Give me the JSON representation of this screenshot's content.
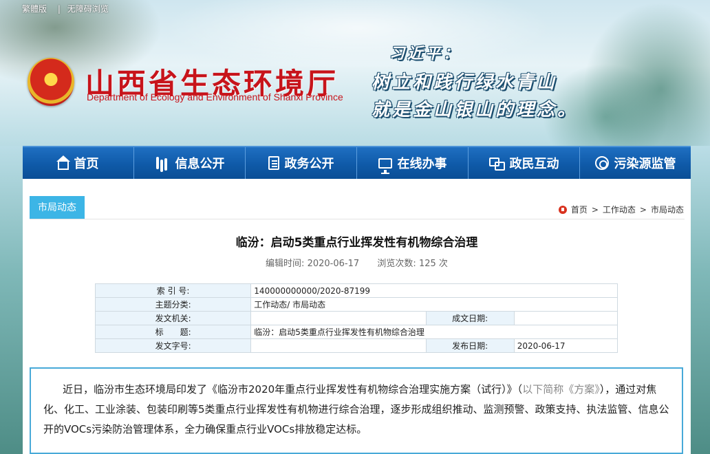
{
  "topbar": {
    "traditional": "繁體版",
    "separator": "|",
    "accessible": "无障碍浏览"
  },
  "header": {
    "site_title": "山西省生态环境厅",
    "site_subtitle": "Department of Ecology and Environment of Shanxi Province",
    "quote_author": "习近平：",
    "quote_line1": "树立和践行绿水青山",
    "quote_line2": "就是金山银山的理念。"
  },
  "nav": {
    "items": [
      {
        "label": "首页",
        "icon": "home-icon"
      },
      {
        "label": "信息公开",
        "icon": "info-bars-icon"
      },
      {
        "label": "政务公开",
        "icon": "document-icon"
      },
      {
        "label": "在线办事",
        "icon": "monitor-icon"
      },
      {
        "label": "政民互动",
        "icon": "interaction-icon"
      },
      {
        "label": "污染源监管",
        "icon": "monitoring-icon"
      }
    ]
  },
  "column": {
    "tag": "市局动态"
  },
  "breadcrumb": {
    "home": "首页",
    "level1": "工作动态",
    "level2": "市局动态",
    "sep": ">"
  },
  "article": {
    "title": "临汾：启动5类重点行业挥发性有机物综合治理",
    "edit_time_label": "编辑时间:",
    "edit_time": "2020-06-17",
    "views_label": "浏览次数:",
    "views": "125",
    "views_unit": "次"
  },
  "info_table": {
    "index_label": "索 引 号:",
    "index_value": "140000000000/2020-87199",
    "category_label": "主题分类:",
    "category_value": "工作动态/ 市局动态",
    "issuer_label": "发文机关:",
    "issuer_value": "",
    "created_label": "成文日期:",
    "created_value": "",
    "title_label": "标　　题:",
    "title_value": "临汾：启动5类重点行业挥发性有机物综合治理",
    "docno_label": "发文字号:",
    "docno_value": "",
    "published_label": "发布日期:",
    "published_value": "2020-06-17"
  },
  "body": {
    "part1": "近日，临汾市生态环境局印发了《临汾市2020年重点行业挥发性有机物综合治理实施方案（试行）》（",
    "part2_grey": "以下简称《方案》",
    "part3": "），通过对焦化、化工、工业涂装、包装印刷等5类重点行业挥发性有机物进行综合治理，逐步形成组织推动、监测预警、政策支持、执法监管、信息公开的VOCs污染防治管理体系，全力确保重点行业VOCs排放稳定达标。"
  }
}
